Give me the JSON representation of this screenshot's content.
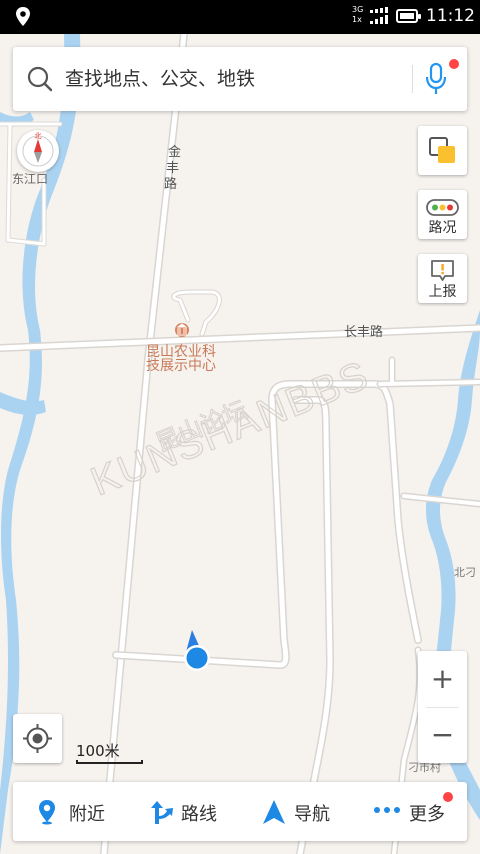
{
  "status_bar": {
    "time": "11:12",
    "network_top": "3G",
    "network_bottom": "1x"
  },
  "search": {
    "placeholder": "查找地点、公交、地铁"
  },
  "map": {
    "labels": {
      "dongjiangkou": "东江口",
      "compass_north": "北",
      "jinfeng_road": "金丰路",
      "changfeng_road": "长丰路",
      "poi_name_line1": "昆山农业科",
      "poi_name_line2": "技展示中心",
      "beiding": "北刁",
      "diaoshi_village": "刁市村",
      "watermark_cn": "昆山论坛",
      "watermark_en": "KUNSHANBBS"
    }
  },
  "controls": {
    "traffic_label": "路况",
    "report_label": "上报",
    "zoom_in": "+",
    "zoom_out": "−",
    "scale_text": "100米"
  },
  "bottom_nav": {
    "nearby": "附近",
    "route": "路线",
    "navigate": "导航",
    "more": "更多"
  },
  "colors": {
    "accent": "#2196f3",
    "badge": "#ff4444",
    "water": "#aad3f2",
    "road": "#ffffff",
    "map_bg": "#f6f2ee"
  }
}
